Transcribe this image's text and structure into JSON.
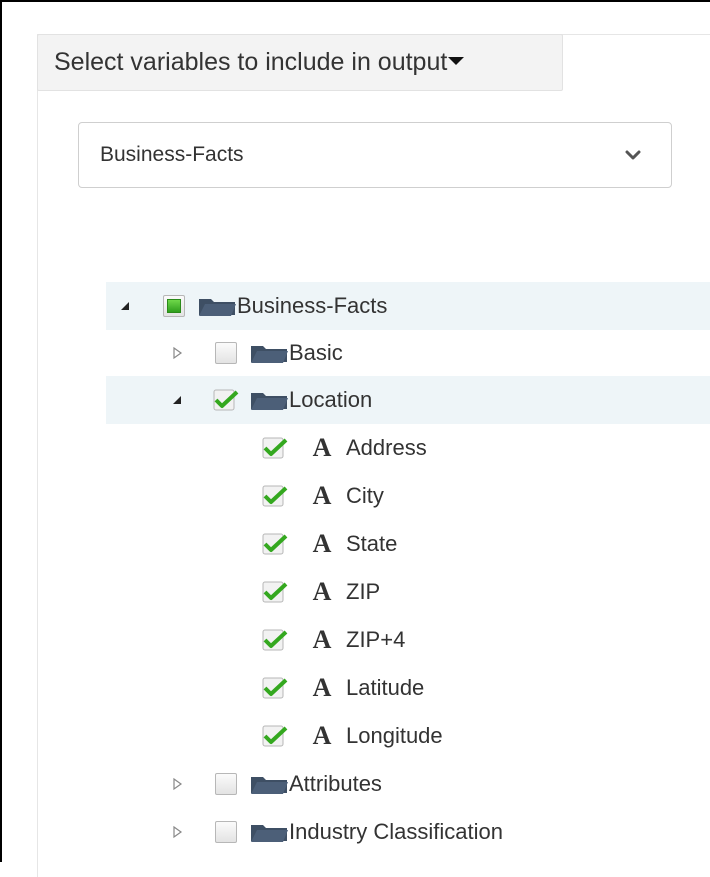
{
  "header": {
    "title": "Select variables to include in output"
  },
  "dataset_select": {
    "selected": "Business-Facts"
  },
  "tree": {
    "root": {
      "label": "Business-Facts",
      "state": "partial",
      "expanded": true
    },
    "basic": {
      "label": "Basic",
      "state": "unchecked",
      "expanded": false
    },
    "location": {
      "label": "Location",
      "state": "checked",
      "expanded": true
    },
    "location_fields": [
      {
        "label": "Address",
        "type_icon": "A",
        "state": "checked"
      },
      {
        "label": "City",
        "type_icon": "A",
        "state": "checked"
      },
      {
        "label": "State",
        "type_icon": "A",
        "state": "checked"
      },
      {
        "label": "ZIP",
        "type_icon": "A",
        "state": "checked"
      },
      {
        "label": "ZIP+4",
        "type_icon": "A",
        "state": "checked"
      },
      {
        "label": "Latitude",
        "type_icon": "A",
        "state": "checked"
      },
      {
        "label": "Longitude",
        "type_icon": "A",
        "state": "checked"
      }
    ],
    "attributes": {
      "label": "Attributes",
      "state": "unchecked",
      "expanded": false
    },
    "industry": {
      "label": "Industry Classification",
      "state": "unchecked",
      "expanded": false
    }
  },
  "colors": {
    "check_green": "#34a81f",
    "folder": "#3e4f64",
    "highlight": "#eef5f8"
  }
}
